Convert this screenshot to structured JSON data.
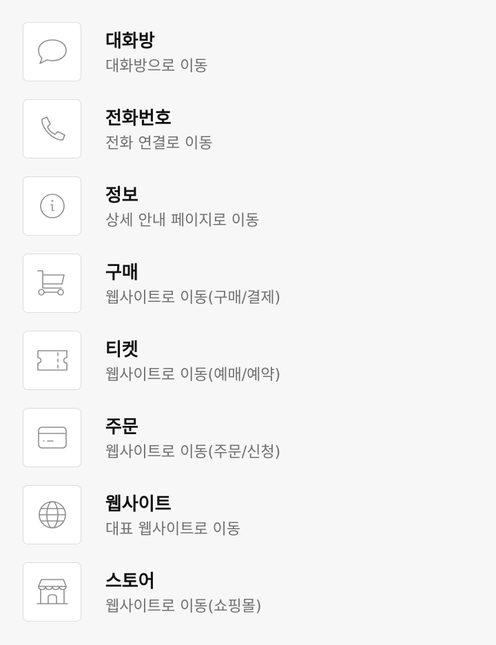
{
  "items": [
    {
      "title": "대화방",
      "desc": "대화방으로 이동",
      "icon": "chat-bubble-icon"
    },
    {
      "title": "전화번호",
      "desc": "전화 연결로 이동",
      "icon": "phone-icon"
    },
    {
      "title": "정보",
      "desc": "상세 안내 페이지로 이동",
      "icon": "info-icon"
    },
    {
      "title": "구매",
      "desc": "웹사이트로 이동(구매/결제)",
      "icon": "cart-icon"
    },
    {
      "title": "티켓",
      "desc": "웹사이트로 이동(예매/예약)",
      "icon": "ticket-icon"
    },
    {
      "title": "주문",
      "desc": "웹사이트로 이동(주문/신청)",
      "icon": "card-icon"
    },
    {
      "title": "웹사이트",
      "desc": "대표 웹사이트로 이동",
      "icon": "globe-icon"
    },
    {
      "title": "스토어",
      "desc": "웹사이트로 이동(쇼핑몰)",
      "icon": "store-icon"
    }
  ],
  "colors": {
    "background": "#f7f7f7",
    "icon_stroke": "#8e8e8e",
    "icon_box_border": "#dcdcdc",
    "title": "#111111",
    "desc": "#6f6f6f"
  }
}
